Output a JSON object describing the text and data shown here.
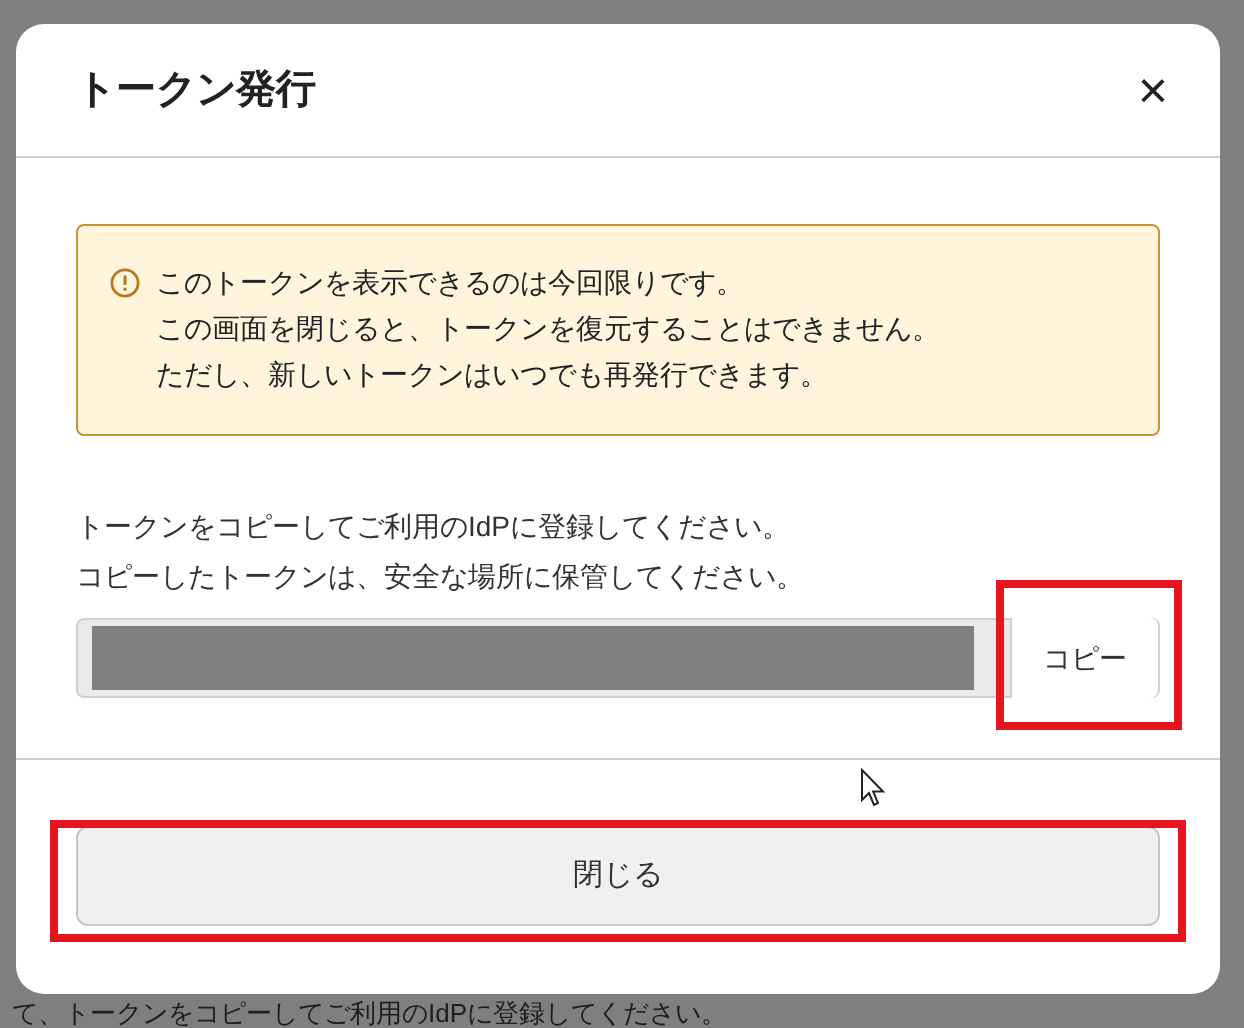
{
  "background": {
    "text": "て、トークンをコピーしてご利用のIdPに登録してください。"
  },
  "dialog": {
    "title": "トークン発行",
    "close": "×",
    "alert": {
      "kind": "warning",
      "lines": [
        "このトークンを表示できるのは今回限りです。",
        "この画面を閉じると、トークンを復元することはできません。",
        "ただし、新しいトークンはいつでも再発行できます。"
      ]
    },
    "instructions": [
      "トークンをコピーしてご利用のIdPに登録してください。",
      "コピーしたトークンは、安全な場所に保管してください。"
    ],
    "copy_button": {
      "label": "コピー",
      "highlighted": true
    },
    "close_button": {
      "label": "閉じる",
      "highlighted": true
    }
  }
}
